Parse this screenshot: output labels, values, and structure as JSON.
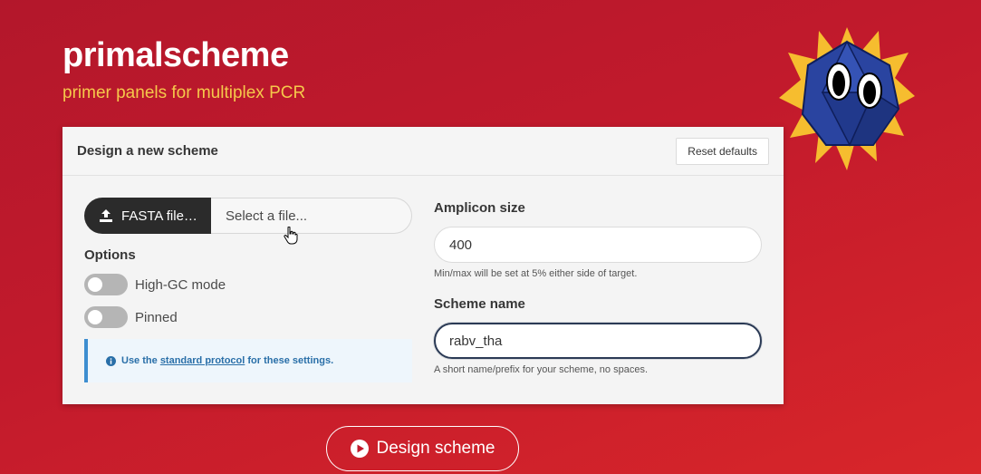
{
  "hero": {
    "title": "primalscheme",
    "subtitle": "primer panels for multiplex PCR"
  },
  "card": {
    "title": "Design a new scheme",
    "reset_label": "Reset defaults"
  },
  "file": {
    "button_label": "FASTA file…",
    "placeholder": "Select a file..."
  },
  "options": {
    "label": "Options",
    "toggles": [
      {
        "label": "High-GC mode",
        "checked": false
      },
      {
        "label": "Pinned",
        "checked": false
      }
    ]
  },
  "notice": {
    "prefix": "Use the",
    "link": "standard protocol",
    "suffix": "for these settings."
  },
  "amplicon": {
    "label": "Amplicon size",
    "value": "400",
    "help": "Min/max will be set at 5% either side of target."
  },
  "scheme_name": {
    "label": "Scheme name",
    "value": "rabv_tha",
    "help": "A short name/prefix for your scheme, no spaces."
  },
  "design_button": {
    "label": "Design scheme"
  },
  "colors": {
    "background": "#c21a2c",
    "subtitle": "#f5c84b",
    "info": "#296fa8"
  }
}
